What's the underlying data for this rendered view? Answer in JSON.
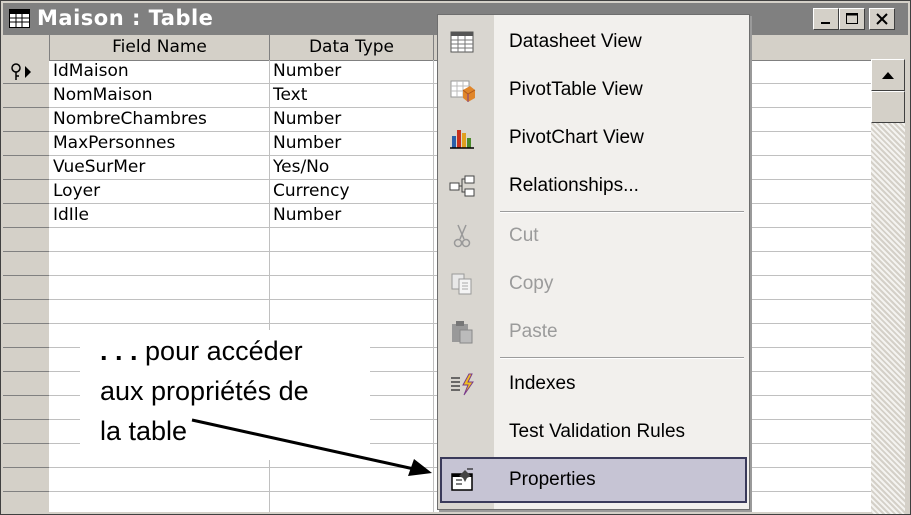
{
  "window": {
    "title": "Maison : Table",
    "controls": [
      "minimize-icon",
      "maximize-icon",
      "close-icon"
    ]
  },
  "table": {
    "columns": [
      "Field Name",
      "Data Type"
    ],
    "rows": [
      {
        "field": "IdMaison",
        "type": "Number",
        "primary_key": true
      },
      {
        "field": "NomMaison",
        "type": "Text"
      },
      {
        "field": "NombreChambres",
        "type": "Number"
      },
      {
        "field": "MaxPersonnes",
        "type": "Number"
      },
      {
        "field": "VueSurMer",
        "type": "Yes/No"
      },
      {
        "field": "Loyer",
        "type": "Currency"
      },
      {
        "field": "IdIle",
        "type": "Number"
      }
    ]
  },
  "context_menu": {
    "items": [
      {
        "label": "Datasheet View",
        "icon": "datasheet-icon",
        "enabled": true
      },
      {
        "label": "PivotTable View",
        "icon": "pivot-table-icon",
        "enabled": true
      },
      {
        "label": "PivotChart View",
        "icon": "pivot-chart-icon",
        "enabled": true
      },
      {
        "label": "Relationships...",
        "icon": "relationships-icon",
        "enabled": true
      },
      {
        "label": "Cut",
        "icon": "cut-icon",
        "enabled": false
      },
      {
        "label": "Copy",
        "icon": "copy-icon",
        "enabled": false
      },
      {
        "label": "Paste",
        "icon": "paste-icon",
        "enabled": false
      },
      {
        "label": "Indexes",
        "icon": "indexes-icon",
        "enabled": true
      },
      {
        "label": "Test Validation Rules",
        "icon": "",
        "enabled": true
      },
      {
        "label": "Properties",
        "icon": "properties-icon",
        "enabled": true,
        "selected": true
      }
    ]
  },
  "annotation": {
    "dots": ". . .",
    "line1": "pour accéder",
    "line2": "aux propriétés de",
    "line3": "la table"
  },
  "colors": {
    "titlebar": "#808080",
    "menu_selected": "#c6c4d4",
    "menu_gutter": "#d9d6d0",
    "disabled_text": "#9b9b9b"
  }
}
